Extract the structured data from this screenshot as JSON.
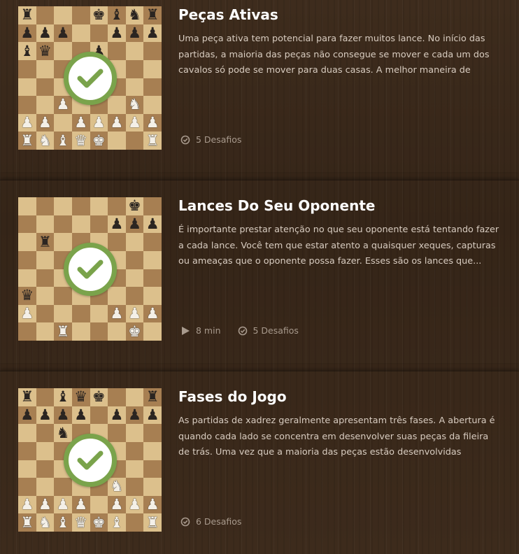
{
  "lessons": [
    {
      "title": "Peças Ativas",
      "description": "Uma peça ativa tem potencial para fazer muitos lance. No início das partidas, a maioria das peças não consegue se mover e cada um dos cavalos só pode se mover para duas casas. A melhor maneira de ativar...",
      "completed": true,
      "duration": "",
      "challenges": "5 Desafios",
      "board": [
        "r . . . k b n r",
        "p p p . . p p p",
        "b q . . p . . .",
        ". . . p . . . .",
        ". . . . . . . .",
        ". . P . . . N .",
        "P P . P P P P P",
        "R N B Q K . . R"
      ]
    },
    {
      "title": "Lances Do Seu Oponente",
      "description": "É importante prestar atenção no que seu oponente está tentando fazer a cada lance. Você tem que estar atento a quaisquer xeques, capturas ou ameaças que o oponente possa fazer. Esses são os lances que...",
      "completed": true,
      "duration": "8 min",
      "challenges": "5 Desafios",
      "board": [
        ". . . . . . k .",
        ". . . . . p p p",
        ". r . . . . . .",
        ". . . . . . . .",
        ". . . . . . . .",
        "q . . . . . . .",
        "P . . . . P P P",
        ". . R . . . K ."
      ]
    },
    {
      "title": "Fases do Jogo",
      "description": "As partidas de xadrez geralmente apresentam três fases. A abertura é quando cada lado se concentra em desenvolver suas peças da fileira de trás. Uma vez que a maioria das peças estão desenvolvidas chegamos ...",
      "completed": true,
      "duration": "",
      "challenges": "6 Desafios",
      "board": [
        "r . b q k . . r",
        "p p p p . p p p",
        ". . n . . . . .",
        ". . . . p . . .",
        ". . . . . . . .",
        ". . . . . N . .",
        "P P P P . P P P",
        "R N B Q K B . R"
      ]
    }
  ],
  "icons": {
    "completed": "check-circle-icon",
    "play": "play-icon",
    "challenge": "check-circle-small-icon"
  },
  "colors": {
    "accent": "#7aa34b",
    "light_square": "#dcc08c",
    "dark_square": "#a77f52"
  }
}
